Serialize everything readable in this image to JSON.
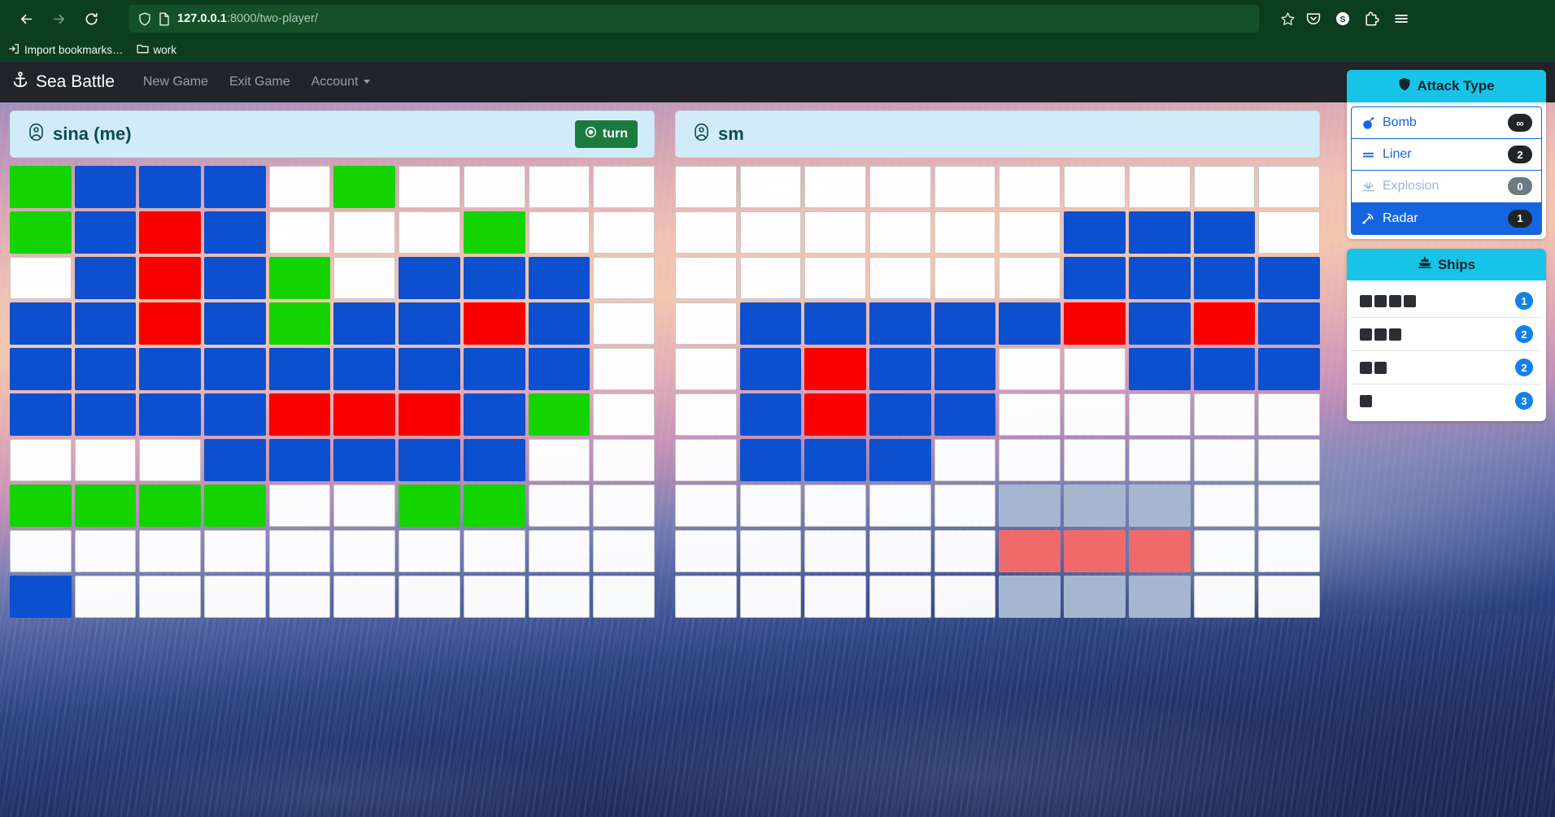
{
  "browser": {
    "url_host": "127.0.0.1",
    "url_rest": ":8000/two-player/",
    "back_icon": "back-arrow-icon",
    "forward_icon": "forward-arrow-icon",
    "reload_icon": "reload-icon",
    "shield_icon": "shield-icon",
    "page_icon": "page-document-icon",
    "star_icon": "bookmark-star-icon",
    "pocket_icon": "save-to-pocket-icon",
    "account_icon": "account-icon",
    "account_letter": "S",
    "extensions_icon": "extensions-icon",
    "menu_icon": "hamburger-menu-icon",
    "bookmarks": [
      {
        "label": "Import bookmarks…",
        "icon": "import-bookmarks-icon"
      },
      {
        "label": "work",
        "icon": "folder-icon"
      }
    ]
  },
  "navbar": {
    "brand": "Sea Battle",
    "brand_icon": "anchor-icon",
    "links": [
      {
        "label": "New Game"
      },
      {
        "label": "Exit Game"
      },
      {
        "label": "Account",
        "caret": true
      }
    ]
  },
  "boards": [
    {
      "player": "sina (me)",
      "avatar_icon": "user-circle-icon",
      "turn_label": "turn",
      "turn_icon": "turn-dot-icon",
      "has_turn": true,
      "rows": [
        [
          "green",
          "blue",
          "blue",
          "blue",
          "empty",
          "green",
          "empty",
          "empty",
          "empty",
          "empty"
        ],
        [
          "green",
          "blue",
          "red",
          "blue",
          "empty",
          "empty",
          "empty",
          "green",
          "empty",
          "empty"
        ],
        [
          "empty",
          "blue",
          "red",
          "blue",
          "green",
          "empty",
          "blue",
          "blue",
          "blue",
          "empty"
        ],
        [
          "blue",
          "blue",
          "red",
          "blue",
          "green",
          "blue",
          "blue",
          "red",
          "blue",
          "empty"
        ],
        [
          "blue",
          "blue",
          "blue",
          "blue",
          "blue",
          "blue",
          "blue",
          "blue",
          "blue",
          "empty"
        ],
        [
          "blue",
          "blue",
          "blue",
          "blue",
          "red",
          "red",
          "red",
          "blue",
          "green",
          "empty"
        ],
        [
          "empty",
          "empty",
          "empty",
          "blue",
          "blue",
          "blue",
          "blue",
          "blue",
          "empty",
          "empty"
        ],
        [
          "green",
          "green",
          "green",
          "green",
          "empty",
          "empty",
          "green",
          "green",
          "empty",
          "empty"
        ],
        [
          "empty",
          "empty",
          "empty",
          "empty",
          "empty",
          "empty",
          "empty",
          "empty",
          "empty",
          "empty"
        ],
        [
          "blue",
          "empty",
          "empty",
          "empty",
          "empty",
          "empty",
          "empty",
          "empty",
          "empty",
          "empty"
        ]
      ]
    },
    {
      "player": "sm",
      "avatar_icon": "user-circle-icon",
      "turn_label": "",
      "has_turn": false,
      "rows": [
        [
          "empty",
          "empty",
          "empty",
          "empty",
          "empty",
          "empty",
          "empty",
          "empty",
          "empty",
          "empty"
        ],
        [
          "empty",
          "empty",
          "empty",
          "empty",
          "empty",
          "empty",
          "blue",
          "blue",
          "blue",
          "empty"
        ],
        [
          "empty",
          "empty",
          "empty",
          "empty",
          "empty",
          "empty",
          "blue",
          "blue",
          "blue",
          "blue"
        ],
        [
          "empty",
          "blue",
          "blue",
          "blue",
          "blue",
          "blue",
          "red",
          "blue",
          "red",
          "blue"
        ],
        [
          "empty",
          "blue",
          "red",
          "blue",
          "blue",
          "empty",
          "empty",
          "blue",
          "blue",
          "blue"
        ],
        [
          "empty",
          "blue",
          "red",
          "blue",
          "blue",
          "empty",
          "empty",
          "empty",
          "empty",
          "empty"
        ],
        [
          "empty",
          "blue",
          "blue",
          "blue",
          "empty",
          "empty",
          "empty",
          "empty",
          "empty",
          "empty"
        ],
        [
          "empty",
          "empty",
          "empty",
          "empty",
          "empty",
          "lightblue",
          "lightblue",
          "lightblue",
          "empty",
          "empty"
        ],
        [
          "empty",
          "empty",
          "empty",
          "empty",
          "empty",
          "lightred",
          "lightred",
          "lightred",
          "empty",
          "empty"
        ],
        [
          "empty",
          "empty",
          "empty",
          "empty",
          "empty",
          "lightblue",
          "lightblue",
          "lightblue",
          "empty",
          "empty"
        ]
      ]
    }
  ],
  "attack_panel": {
    "title": "Attack Type",
    "title_icon": "shield-icon",
    "items": [
      {
        "label": "Bomb",
        "count": "∞",
        "icon": "bomb-icon",
        "state": "normal"
      },
      {
        "label": "Liner",
        "count": "2",
        "icon": "liner-icon",
        "state": "normal"
      },
      {
        "label": "Explosion",
        "count": "0",
        "icon": "explosion-icon",
        "state": "disabled"
      },
      {
        "label": "Radar",
        "count": "1",
        "icon": "radar-icon",
        "state": "active"
      }
    ]
  },
  "ships_panel": {
    "title": "Ships",
    "title_icon": "ship-icon",
    "rows": [
      {
        "size": 4,
        "count": "1"
      },
      {
        "size": 3,
        "count": "2"
      },
      {
        "size": 2,
        "count": "2"
      },
      {
        "size": 1,
        "count": "3"
      }
    ]
  }
}
